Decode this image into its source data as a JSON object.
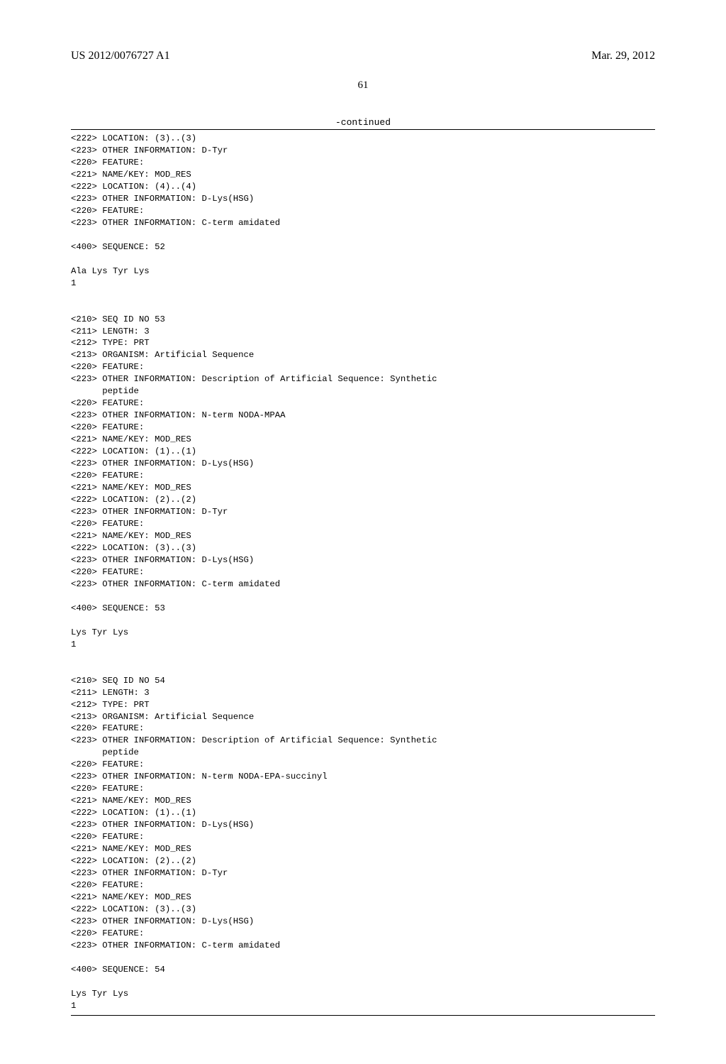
{
  "header": {
    "pub_number": "US 2012/0076727 A1",
    "pub_date": "Mar. 29, 2012"
  },
  "page_number": "61",
  "continued_label": "-continued",
  "seq_text": "<222> LOCATION: (3)..(3)\n<223> OTHER INFORMATION: D-Tyr\n<220> FEATURE:\n<221> NAME/KEY: MOD_RES\n<222> LOCATION: (4)..(4)\n<223> OTHER INFORMATION: D-Lys(HSG)\n<220> FEATURE:\n<223> OTHER INFORMATION: C-term amidated\n\n<400> SEQUENCE: 52\n\nAla Lys Tyr Lys\n1\n\n\n<210> SEQ ID NO 53\n<211> LENGTH: 3\n<212> TYPE: PRT\n<213> ORGANISM: Artificial Sequence\n<220> FEATURE:\n<223> OTHER INFORMATION: Description of Artificial Sequence: Synthetic\n      peptide\n<220> FEATURE:\n<223> OTHER INFORMATION: N-term NODA-MPAA\n<220> FEATURE:\n<221> NAME/KEY: MOD_RES\n<222> LOCATION: (1)..(1)\n<223> OTHER INFORMATION: D-Lys(HSG)\n<220> FEATURE:\n<221> NAME/KEY: MOD_RES\n<222> LOCATION: (2)..(2)\n<223> OTHER INFORMATION: D-Tyr\n<220> FEATURE:\n<221> NAME/KEY: MOD_RES\n<222> LOCATION: (3)..(3)\n<223> OTHER INFORMATION: D-Lys(HSG)\n<220> FEATURE:\n<223> OTHER INFORMATION: C-term amidated\n\n<400> SEQUENCE: 53\n\nLys Tyr Lys\n1\n\n\n<210> SEQ ID NO 54\n<211> LENGTH: 3\n<212> TYPE: PRT\n<213> ORGANISM: Artificial Sequence\n<220> FEATURE:\n<223> OTHER INFORMATION: Description of Artificial Sequence: Synthetic\n      peptide\n<220> FEATURE:\n<223> OTHER INFORMATION: N-term NODA-EPA-succinyl\n<220> FEATURE:\n<221> NAME/KEY: MOD_RES\n<222> LOCATION: (1)..(1)\n<223> OTHER INFORMATION: D-Lys(HSG)\n<220> FEATURE:\n<221> NAME/KEY: MOD_RES\n<222> LOCATION: (2)..(2)\n<223> OTHER INFORMATION: D-Tyr\n<220> FEATURE:\n<221> NAME/KEY: MOD_RES\n<222> LOCATION: (3)..(3)\n<223> OTHER INFORMATION: D-Lys(HSG)\n<220> FEATURE:\n<223> OTHER INFORMATION: C-term amidated\n\n<400> SEQUENCE: 54\n\nLys Tyr Lys\n1"
}
